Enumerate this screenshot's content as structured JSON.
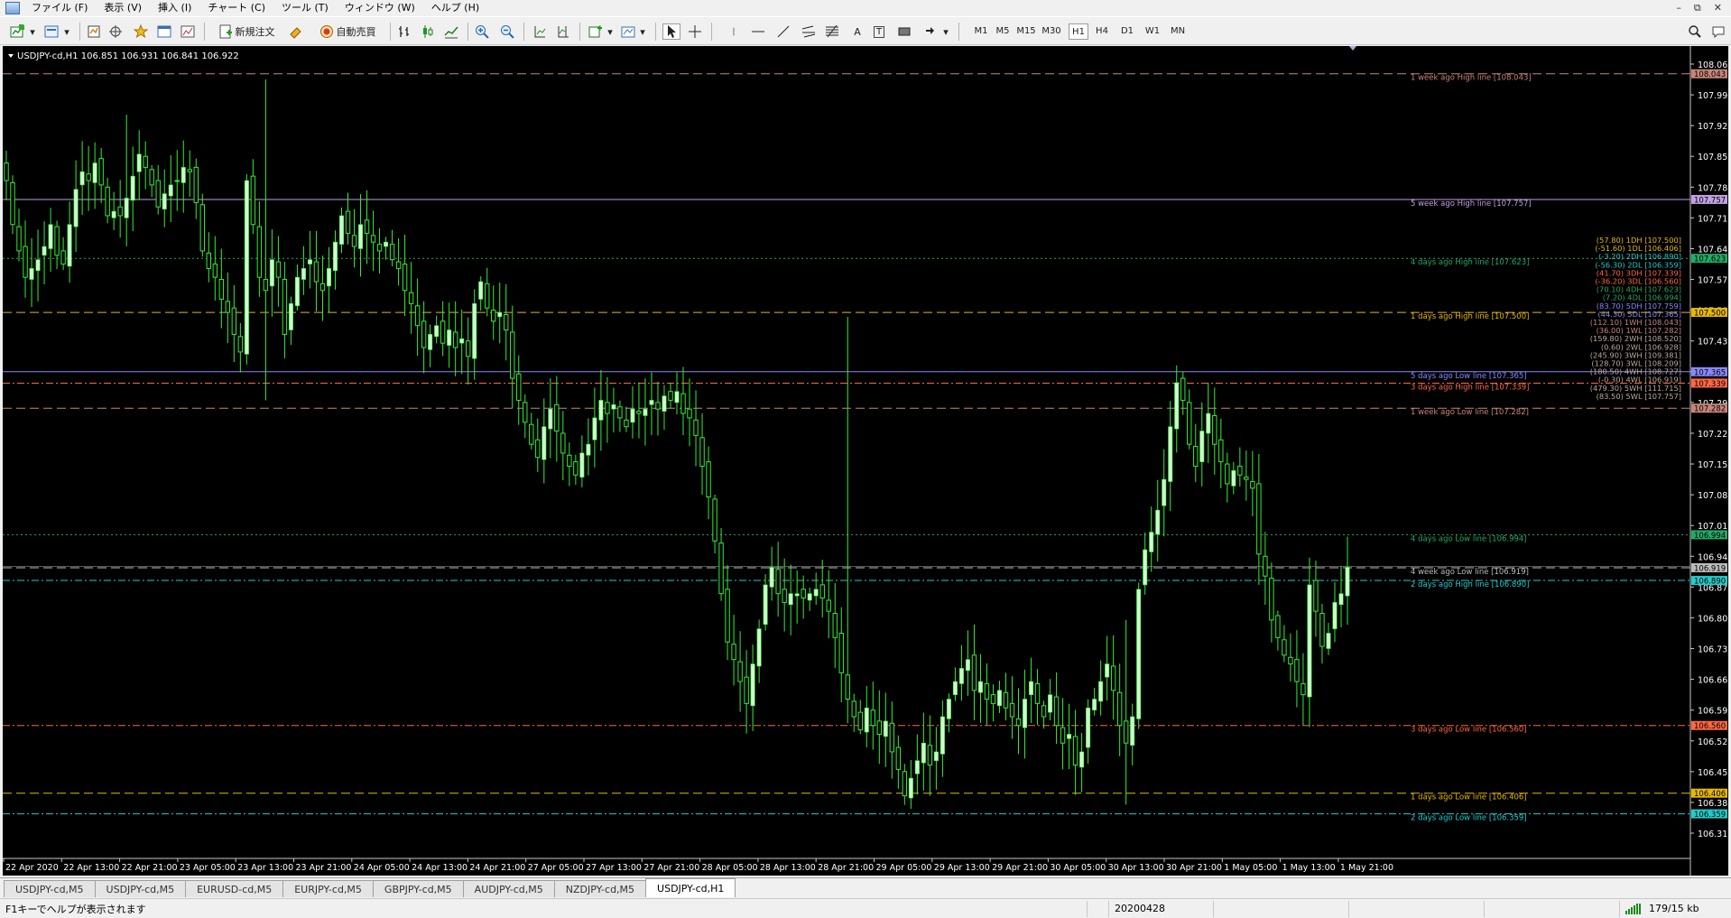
{
  "menu": [
    "ファイル (F)",
    "表示 (V)",
    "挿入 (I)",
    "チャート (C)",
    "ツール (T)",
    "ウィンドウ (W)",
    "ヘルプ (H)"
  ],
  "toolbar": {
    "new_order_label": "新規注文",
    "auto_trade_label": "自動売買",
    "timeframes": [
      "M1",
      "M5",
      "M15",
      "M30",
      "H1",
      "H4",
      "D1",
      "W1",
      "MN"
    ],
    "active_timeframe": "H1",
    "text_tool": "A",
    "text_label_tool": "T"
  },
  "chart": {
    "symbol_info": "USDJPY-cd,H1  106.851 106.931 106.841 106.922",
    "colors": {
      "background": "#000000",
      "bull_body": "#ccffcc",
      "wick": "#33ee33",
      "axis_text": "#ffffff"
    },
    "y_ticks": [
      "108.065",
      "107.995",
      "107.925",
      "107.855",
      "107.785",
      "107.715",
      "107.645",
      "107.575",
      "107.505",
      "107.435",
      "107.365",
      "107.295",
      "107.225",
      "107.155",
      "107.085",
      "107.015",
      "106.945",
      "106.875",
      "106.805",
      "106.735",
      "106.665",
      "106.595",
      "106.525",
      "106.455",
      "106.385",
      "106.315"
    ],
    "x_ticks": [
      "22 Apr 2020",
      "22 Apr 13:00",
      "22 Apr 21:00",
      "23 Apr 05:00",
      "23 Apr 13:00",
      "23 Apr 21:00",
      "24 Apr 05:00",
      "24 Apr 13:00",
      "24 Apr 21:00",
      "27 Apr 05:00",
      "27 Apr 13:00",
      "27 Apr 21:00",
      "28 Apr 05:00",
      "28 Apr 13:00",
      "28 Apr 21:00",
      "29 Apr 05:00",
      "29 Apr 13:00",
      "29 Apr 21:00",
      "30 Apr 05:00",
      "30 Apr 13:00",
      "30 Apr 21:00",
      "1 May 05:00",
      "1 May 13:00",
      "1 May 21:00"
    ],
    "levels": [
      {
        "label": "1 week ago High line [108.043]",
        "price_tag": "108.043",
        "color": "#c8857a",
        "style": "dash"
      },
      {
        "label": "5 week ago High line [107.757]",
        "price_tag": "107.757",
        "color": "#c0a0e0",
        "style": "solid"
      },
      {
        "label": "4 days ago High line [107.623]",
        "price_tag": "107.623",
        "color": "#22aa66",
        "style": "dot"
      },
      {
        "label": "1 days ago High line [107.500]",
        "price_tag": "107.500",
        "color": "#e6b800",
        "style": "dash"
      },
      {
        "label": "5 days ago Low line [107.365]",
        "price_tag": "107.365",
        "color": "#8888ff",
        "style": "solid"
      },
      {
        "label": "3 days ago High line [107.339]",
        "price_tag": "107.339",
        "color": "#ff6644",
        "style": "dashdot"
      },
      {
        "label": "1 week ago Low line [107.282]",
        "price_tag": "107.282",
        "color": "#c8857a",
        "style": "dash"
      },
      {
        "label": "4 days ago Low line [106.994]",
        "price_tag": "106.994",
        "color": "#22aa66",
        "style": "dot"
      },
      {
        "label": "4 week ago Low line [106.919]",
        "price_tag": "106.919",
        "color": "#bbbbbb",
        "style": "dash"
      },
      {
        "label": "2 days ago High line [106.890]",
        "price_tag": "106.890",
        "color": "#22cccc",
        "style": "dashdot"
      },
      {
        "label": "3 days ago Low line [106.560]",
        "price_tag": "106.560",
        "color": "#ff6644",
        "style": "dashdot"
      },
      {
        "label": "1 days ago Low line [106.406]",
        "price_tag": "106.406",
        "color": "#e6b800",
        "style": "dash"
      },
      {
        "label": "2 days ago Low line [106.359]",
        "price_tag": "106.359",
        "color": "#22cccc",
        "style": "dashdot"
      }
    ],
    "summary": [
      {
        "text": "(57.80) 1DH [107.500]",
        "color": "#e6b800"
      },
      {
        "text": "(-51.60) 1DL [106.406]",
        "color": "#e6b800"
      },
      {
        "text": "(-3.20) 2DH [106.890]",
        "color": "#22cccc"
      },
      {
        "text": "(-56.30) 2DL [106.359]",
        "color": "#22cccc"
      },
      {
        "text": "(41.70) 3DH [107.339]",
        "color": "#ff6644"
      },
      {
        "text": "(-36.20) 3DL [106.560]",
        "color": "#ff6644"
      },
      {
        "text": "(70.10) 4DH [107.623]",
        "color": "#22aa66"
      },
      {
        "text": "(7.20) 4DL [106.994]",
        "color": "#22aa66"
      },
      {
        "text": "(83.70) 5DH [107.759]",
        "color": "#8888ff"
      },
      {
        "text": "(44.30) 5DL [107.365]",
        "color": "#8888ff"
      },
      {
        "text": "(112.10) 1WH [108.043]",
        "color": "#c8857a"
      },
      {
        "text": "(36.00) 1WL [107.282]",
        "color": "#c8857a"
      },
      {
        "text": "(159.80) 2WH [108.520]",
        "color": "#bbaa99"
      },
      {
        "text": "(0.60) 2WL [106.928]",
        "color": "#bbaa99"
      },
      {
        "text": "(245.90) 3WH [109.381]",
        "color": "#bbaa99"
      },
      {
        "text": "(128.70) 3WL [108.209]",
        "color": "#bbaa99"
      },
      {
        "text": "(180.50) 4WH [108.727]",
        "color": "#bbaa99"
      },
      {
        "text": "(-0.30) 4WL [106.919]",
        "color": "#bbaa99"
      },
      {
        "text": "(479.30) 5WH [111.715]",
        "color": "#bbaa99"
      },
      {
        "text": "(83.50) 5WL [107.757]",
        "color": "#bbaa99"
      }
    ]
  },
  "tabs": [
    "USDJPY-cd,M5",
    "USDJPY-cd,M5",
    "EURUSD-cd,M5",
    "EURJPY-cd,M5",
    "GBPJPY-cd,M5",
    "AUDJPY-cd,M5",
    "NZDJPY-cd,M5",
    "USDJPY-cd,H1"
  ],
  "active_tab": 7,
  "status": {
    "help_text": "F1キーでヘルプが表示されます",
    "date": "20200428",
    "traffic": "179/15 kb"
  }
}
